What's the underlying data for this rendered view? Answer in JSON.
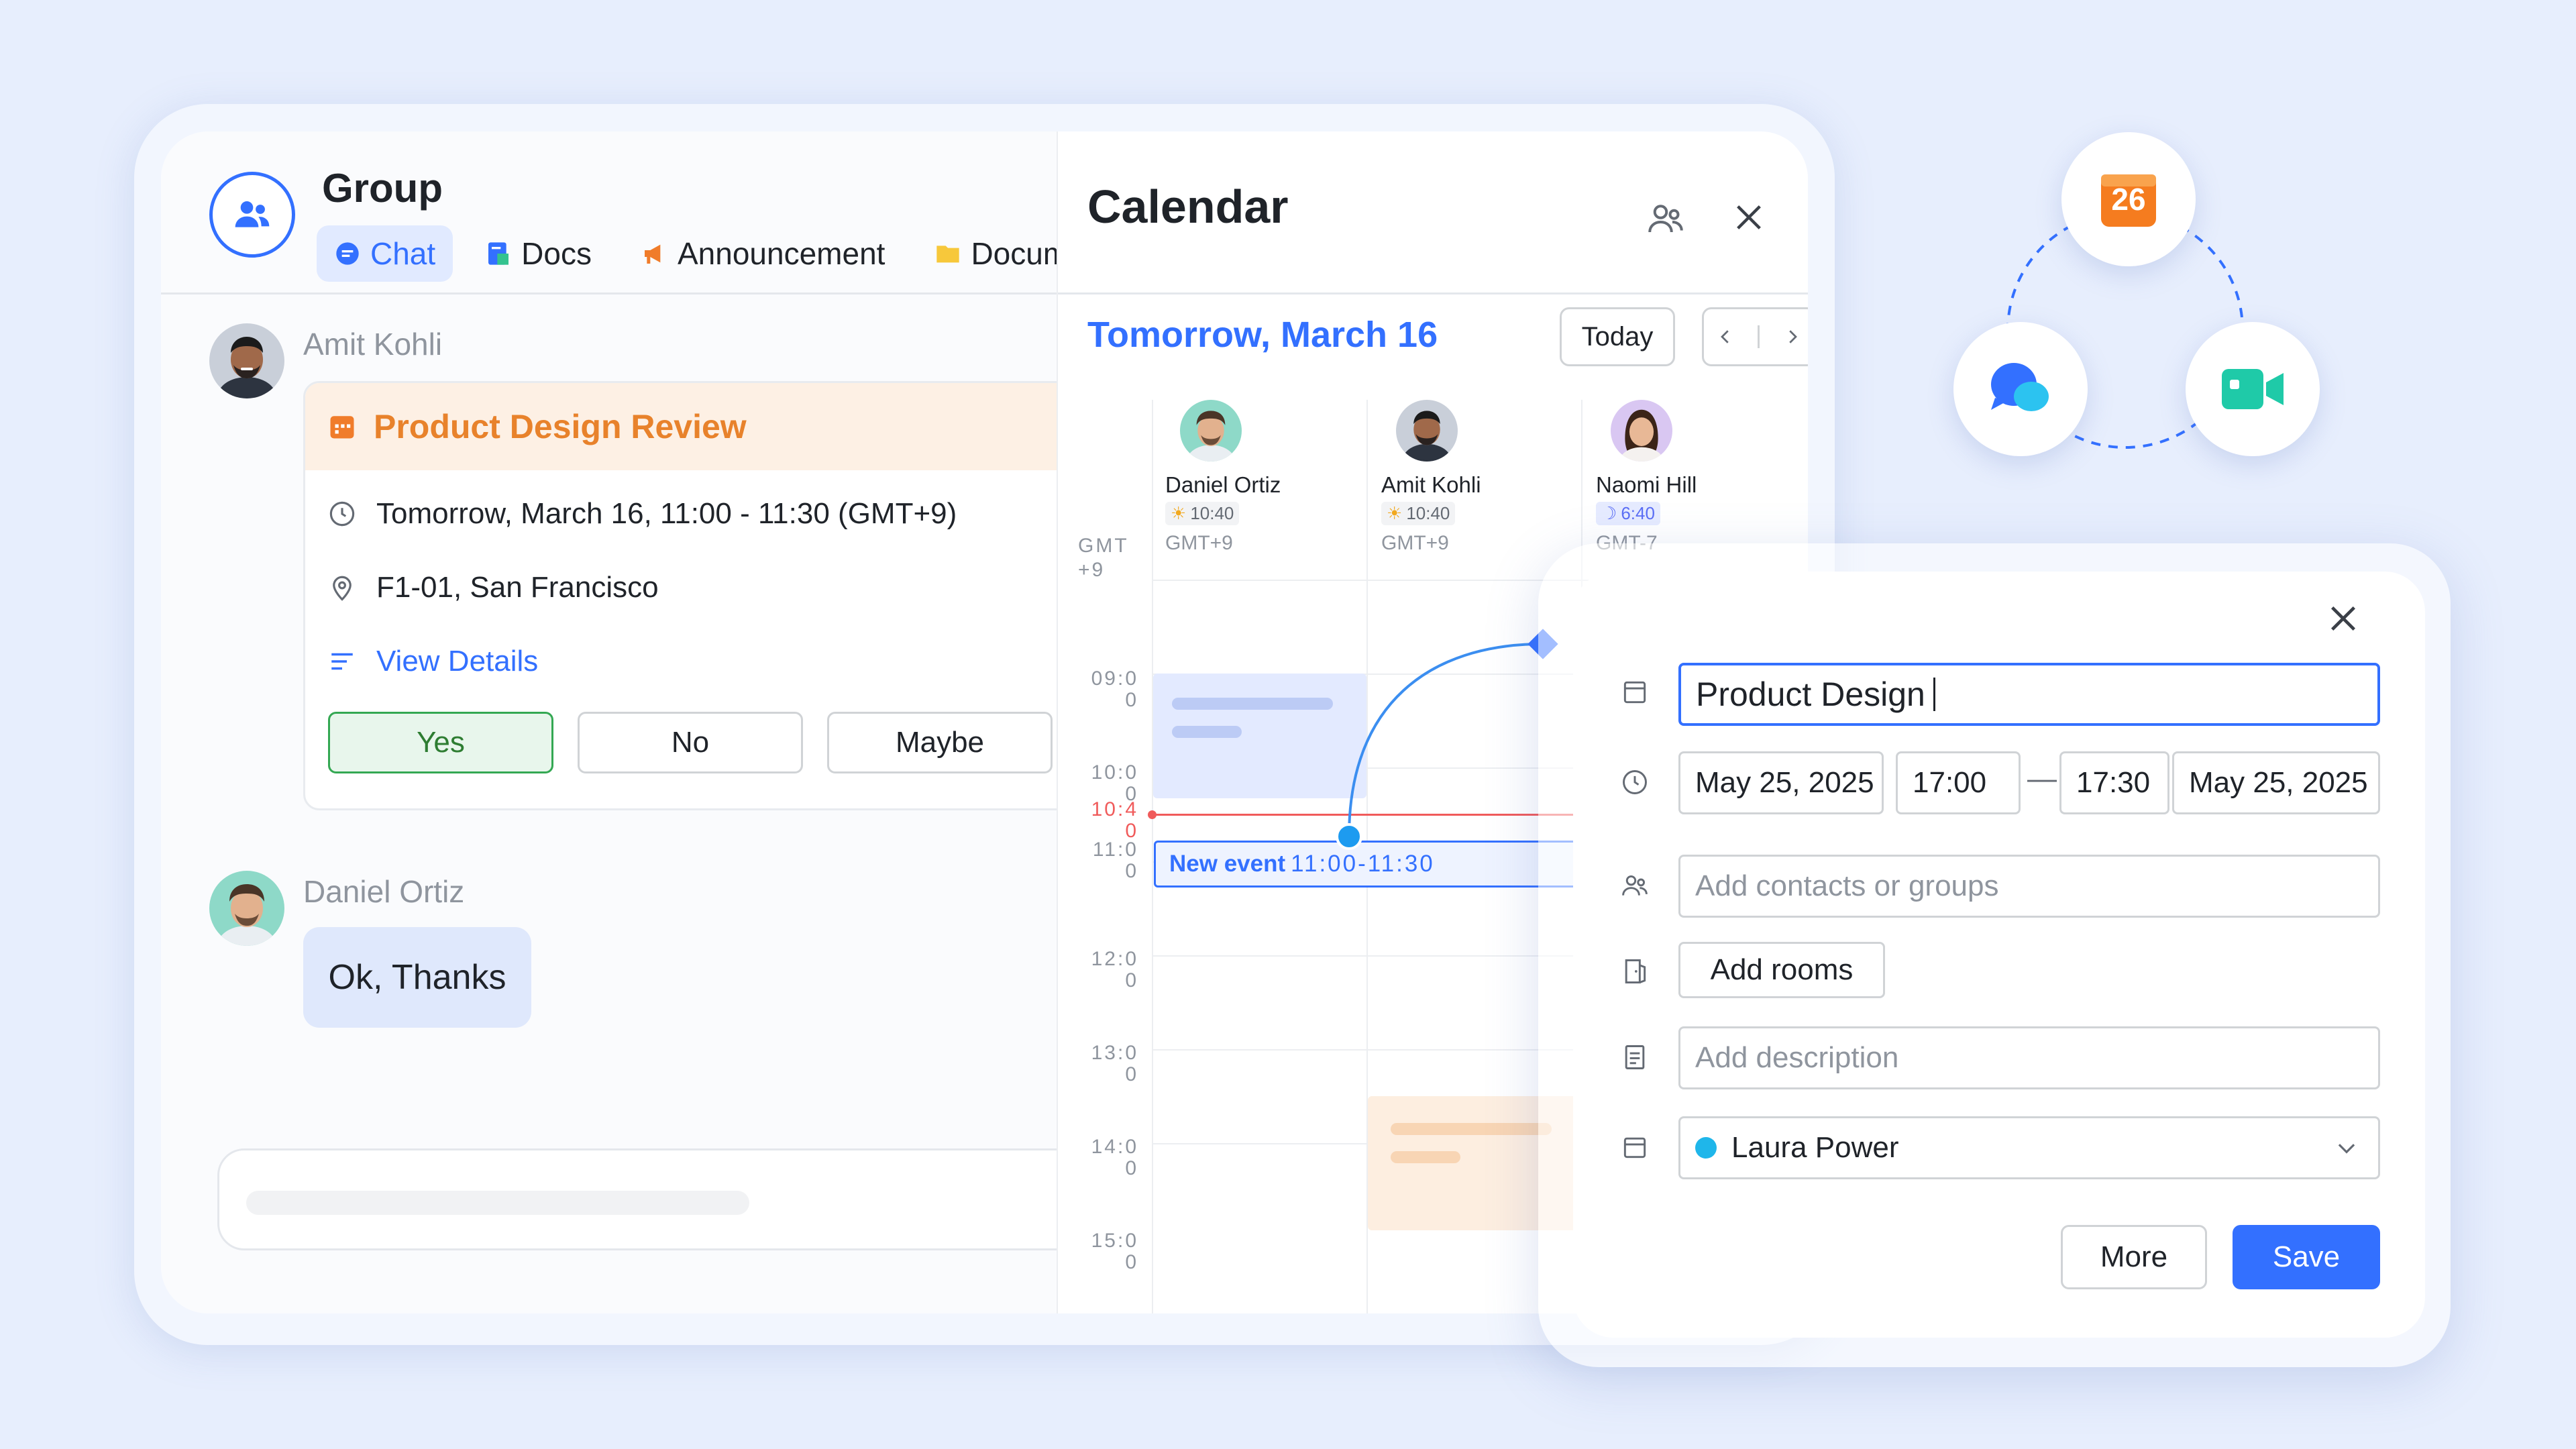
{
  "chat_panel": {
    "title": "Group",
    "tabs": [
      {
        "label": "Chat",
        "icon": "chat-icon",
        "active": true
      },
      {
        "label": "Docs",
        "icon": "docs-icon",
        "active": false
      },
      {
        "label": "Announcement",
        "icon": "announcement-icon",
        "active": false
      },
      {
        "label": "Docum",
        "icon": "folder-icon",
        "active": false
      }
    ],
    "messages": [
      {
        "sender": "Amit Kohli"
      },
      {
        "sender": "Daniel Ortiz",
        "text": "Ok, Thanks"
      }
    ],
    "event_card": {
      "title": "Product Design Review",
      "time": "Tomorrow, March 16, 11:00 - 11:30 (GMT+9)",
      "location": "F1-01, San Francisco",
      "details_link": "View Details",
      "rsvp": {
        "yes": "Yes",
        "no": "No",
        "maybe": "Maybe",
        "selected": "Yes"
      }
    }
  },
  "calendar": {
    "title": "Calendar",
    "date_heading": "Tomorrow, March 16",
    "today_button": "Today",
    "timezone_label": [
      "GMT",
      "+9"
    ],
    "people": [
      {
        "name": "Daniel Ortiz",
        "local_time": "10:40",
        "period": "day",
        "tz": "GMT+9"
      },
      {
        "name": "Amit Kohli",
        "local_time": "10:40",
        "period": "day",
        "tz": "GMT+9"
      },
      {
        "name": "Naomi Hill",
        "local_time": "6:40",
        "period": "night",
        "tz": "GMT-7"
      }
    ],
    "hours": [
      [
        "09:0",
        "0"
      ],
      [
        "10:0",
        "0"
      ],
      [
        "11:0",
        "0"
      ],
      [
        "12:0",
        "0"
      ],
      [
        "13:0",
        "0"
      ],
      [
        "14:0",
        "0"
      ],
      [
        "15:0",
        "0"
      ]
    ],
    "current_time": [
      "10:4",
      "0"
    ],
    "new_event": {
      "label": "New event",
      "time": "11:00-11:30"
    }
  },
  "event_dialog": {
    "title_value": "Product Design",
    "start_date": "May 25, 2025",
    "start_time": "17:00",
    "separator": "—",
    "end_time": "17:30",
    "end_date": "May 25, 2025",
    "guests_placeholder": "Add contacts or groups",
    "rooms_button": "Add rooms",
    "description_placeholder": "Add description",
    "calendar_owner": "Laura Power",
    "calendar_color": "#1fb6ea",
    "more_button": "More",
    "save_button": "Save"
  },
  "integrations": {
    "calendar_badge": "26",
    "items": [
      "calendar-app-icon",
      "messenger-app-icon",
      "video-meeting-app-icon"
    ]
  },
  "colors": {
    "accent": "#3370ff",
    "event_orange": "#e8822b",
    "rsvp_green": "#34a853",
    "now_red": "#f05b5b"
  }
}
